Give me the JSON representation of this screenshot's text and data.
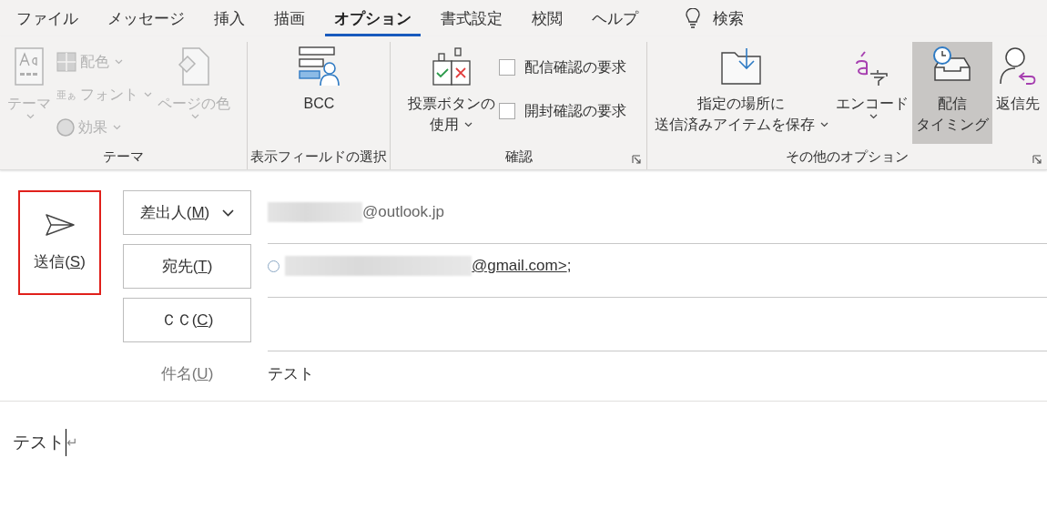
{
  "tabs": [
    {
      "label": "ファイル",
      "selected": false
    },
    {
      "label": "メッセージ",
      "selected": false
    },
    {
      "label": "挿入",
      "selected": false
    },
    {
      "label": "描画",
      "selected": false
    },
    {
      "label": "オプション",
      "selected": true
    },
    {
      "label": "書式設定",
      "selected": false
    },
    {
      "label": "校閲",
      "selected": false
    },
    {
      "label": "ヘルプ",
      "selected": false
    }
  ],
  "search": {
    "label": "検索"
  },
  "ribbon_groups": [
    {
      "label": "テーマ",
      "launcher": false,
      "items": [
        {
          "kind": "large",
          "lines": [
            "テーマ"
          ],
          "dropdown": true,
          "disabled": true
        },
        {
          "kind": "stack",
          "items": [
            {
              "kind": "small",
              "label": "配色",
              "dropdown": true,
              "disabled": true
            },
            {
              "kind": "small",
              "label": "フォント",
              "prefix": "亜ぁ",
              "dropdown": true,
              "disabled": true
            },
            {
              "kind": "small",
              "label": "効果",
              "dropdown": true,
              "disabled": true
            }
          ]
        },
        {
          "kind": "large",
          "lines": [
            "ページの色"
          ],
          "dropdown": true,
          "disabled": true
        }
      ]
    },
    {
      "label": "表示フィールドの選択",
      "launcher": false,
      "items": [
        {
          "kind": "large",
          "lines": [
            "BCC"
          ],
          "dropdown": false,
          "disabled": false
        }
      ]
    },
    {
      "label": "確認",
      "launcher": true,
      "items": [
        {
          "kind": "large",
          "lines": [
            "投票ボタンの",
            "使用"
          ],
          "dropdown": true,
          "disabled": false
        },
        {
          "kind": "stack",
          "items": [
            {
              "kind": "checkbox",
              "label": "配信確認の要求",
              "checked": false
            },
            {
              "kind": "checkbox",
              "label": "開封確認の要求",
              "checked": false
            }
          ]
        }
      ]
    },
    {
      "label": "その他のオプション",
      "launcher": true,
      "items": [
        {
          "kind": "large",
          "lines": [
            "指定の場所に",
            "送信済みアイテムを保存"
          ],
          "dropdown": true,
          "disabled": false,
          "pressed": false
        },
        {
          "kind": "large",
          "lines": [
            "エンコード"
          ],
          "dropdown": true,
          "disabled": false,
          "pressed": false
        },
        {
          "kind": "large",
          "lines": [
            "配信",
            "タイミング"
          ],
          "dropdown": false,
          "disabled": false,
          "pressed": true
        },
        {
          "kind": "large",
          "lines": [
            "返信先"
          ],
          "dropdown": false,
          "disabled": false,
          "pressed": false
        }
      ]
    }
  ],
  "send_button": {
    "label": {
      "before": "送信(",
      "key": "S",
      "after": ")"
    },
    "highlighted": true
  },
  "fields": [
    {
      "kind": "from",
      "button": {
        "before": "差出人(",
        "key": "M",
        "after": ")"
      },
      "dropdown": true,
      "blurred": true,
      "value": "@outlook.jp"
    },
    {
      "kind": "to",
      "button": {
        "before": "宛先(",
        "key": "T",
        "after": ")"
      },
      "blurred": true,
      "link": "@gmail.com>",
      "after": ";"
    },
    {
      "kind": "cc",
      "button": {
        "before": "ＣＣ(",
        "key": "C",
        "after": ")"
      }
    },
    {
      "kind": "subject",
      "label": {
        "before": "件名(",
        "key": "U",
        "after": ")"
      },
      "value": "テスト"
    }
  ],
  "body": {
    "text": "テスト",
    "paragraph_mark": "↵"
  }
}
